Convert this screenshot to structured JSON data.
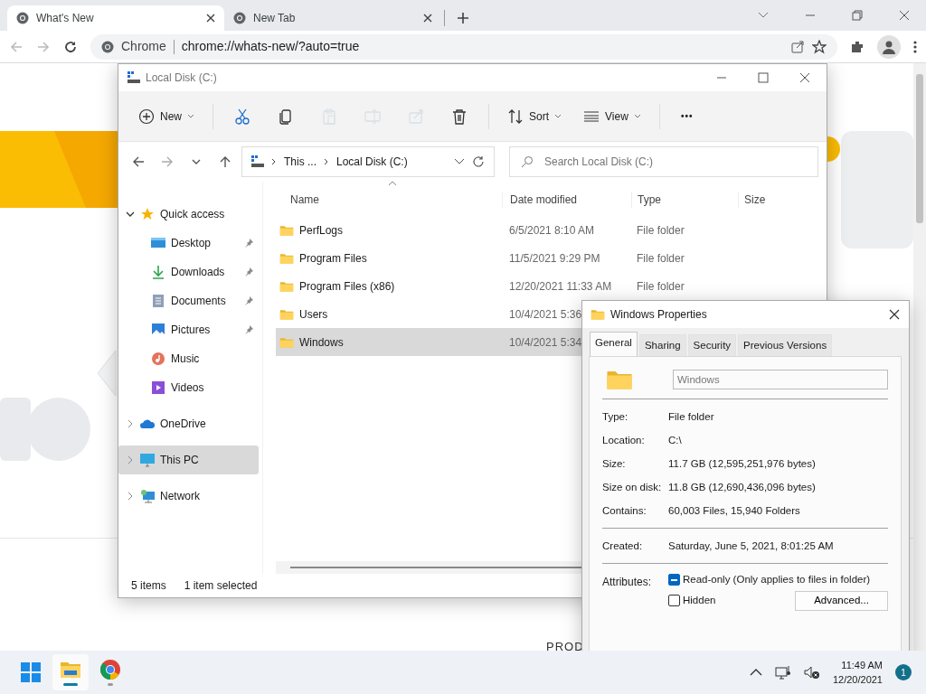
{
  "browser": {
    "tabs": [
      {
        "title": "What's New",
        "selected": true
      },
      {
        "title": "New Tab",
        "selected": false
      }
    ],
    "address": {
      "site": "Chrome",
      "url": "chrome://whats-new/?auto=true"
    }
  },
  "page": {
    "text": "PROD"
  },
  "explorer": {
    "title": "Local Disk (C:)",
    "toolbar": [
      {
        "kind": "menu",
        "label": "New"
      },
      {
        "kind": "icon",
        "disabled": false
      },
      {
        "kind": "icon",
        "disabled": false
      },
      {
        "kind": "icon",
        "disabled": true
      },
      {
        "kind": "icon",
        "disabled": true
      },
      {
        "kind": "icon",
        "disabled": true
      },
      {
        "kind": "icon",
        "disabled": false
      },
      {
        "kind": "menu",
        "label": "Sort"
      },
      {
        "kind": "menu",
        "label": "View"
      },
      {
        "kind": "more",
        "label": "•••"
      }
    ],
    "breadcrumb": [
      "This ...",
      "Local Disk (C:)"
    ],
    "search": {
      "placeholder": "Search Local Disk (C:)"
    },
    "nav": [
      {
        "label": "Quick access",
        "expanded": true,
        "selected": false,
        "children": [
          {
            "label": "Desktop",
            "pinned": true
          },
          {
            "label": "Downloads",
            "pinned": true
          },
          {
            "label": "Documents",
            "pinned": true
          },
          {
            "label": "Pictures",
            "pinned": true
          },
          {
            "label": "Music",
            "pinned": false
          },
          {
            "label": "Videos",
            "pinned": false
          }
        ]
      },
      {
        "label": "OneDrive",
        "expanded": false,
        "selected": false
      },
      {
        "label": "This PC",
        "expanded": false,
        "selected": true
      },
      {
        "label": "Network",
        "expanded": false,
        "selected": false
      }
    ],
    "columns": [
      "Name",
      "Date modified",
      "Type",
      "Size"
    ],
    "files": [
      {
        "name": "PerfLogs",
        "date": "6/5/2021 8:10 AM",
        "type": "File folder",
        "selected": false
      },
      {
        "name": "Program Files",
        "date": "11/5/2021 9:29 PM",
        "type": "File folder",
        "selected": false
      },
      {
        "name": "Program Files (x86)",
        "date": "12/20/2021 11:33 AM",
        "type": "File folder",
        "selected": false
      },
      {
        "name": "Users",
        "date": "10/4/2021 5:36",
        "selected": false
      },
      {
        "name": "Windows",
        "date": "10/4/2021 5:34",
        "selected": true
      }
    ],
    "status": [
      "5 items",
      "1 item selected"
    ]
  },
  "properties": {
    "title": "Windows Properties",
    "tabs": [
      {
        "label": "General",
        "selected": true
      },
      {
        "label": "Sharing",
        "selected": false
      },
      {
        "label": "Security",
        "selected": false
      },
      {
        "label": "Previous Versions",
        "selected": false
      }
    ],
    "name": "Windows",
    "groups": [
      [
        {
          "label": "Type:",
          "value": "File folder"
        },
        {
          "label": "Location:",
          "value": "C:\\"
        },
        {
          "label": "Size:",
          "value": "11.7 GB (12,595,251,976 bytes)"
        },
        {
          "label": "Size on disk:",
          "value": "11.8 GB (12,690,436,096 bytes)"
        },
        {
          "label": "Contains:",
          "value": "60,003 Files, 15,940 Folders"
        }
      ],
      [
        {
          "label": "Created:",
          "value": "Saturday, June 5, 2021, 8:01:25 AM"
        }
      ]
    ],
    "attributes": {
      "label": "Attributes:",
      "items": [
        {
          "label": "Read-only (Only applies to files in folder)",
          "checked": false,
          "indeterminate": true
        },
        {
          "label": "Hidden",
          "checked": false,
          "indeterminate": false
        }
      ]
    },
    "advanced_button": "Advanced..."
  },
  "taskbar": {
    "apps": [
      {
        "kind": "start",
        "selected": false
      },
      {
        "kind": "explorer",
        "selected": true
      },
      {
        "kind": "chrome",
        "selected": false
      }
    ],
    "time": "11:49 AM",
    "date": "12/20/2021",
    "notifications": "1"
  }
}
